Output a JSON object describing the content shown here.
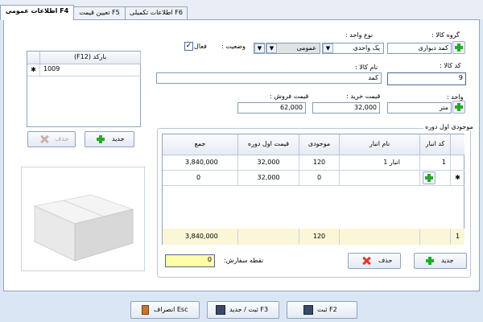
{
  "tabs": [
    {
      "label": "اطلاعات عمومی F4"
    },
    {
      "label": "تعیین قیمت F5"
    },
    {
      "label": "اطلاعات تکمیلی F6"
    }
  ],
  "form": {
    "item_group": {
      "label": "گروه کالا :",
      "value": "کمد دیواری"
    },
    "unit_type": {
      "label": "نوع واحد :",
      "value": "یک واحدی",
      "secondary_value": "عمومی"
    },
    "status": {
      "label": "وضعیت :",
      "checkbox_label": "فعال",
      "checked": true
    },
    "item_code": {
      "label": "کد کالا :",
      "value": "9"
    },
    "item_name": {
      "label": "نام کالا :",
      "value": "کمد"
    },
    "unit": {
      "label": "واحد :",
      "value": "متر"
    },
    "purchase_price": {
      "label": "قیمت خرید :",
      "value": "32,000"
    },
    "sale_price": {
      "label": "قیمت فروش :",
      "value": "62,000"
    }
  },
  "barcode": {
    "header": "(F12) بارکد",
    "rows": [
      "1009"
    ],
    "new_label": "جدید",
    "delete_label": "حذف"
  },
  "inventory": {
    "title": "موجودی اول دوره",
    "columns": [
      "کد انبار",
      "نام انبار",
      "موجودی",
      "قیمت اول دوره",
      "جمع"
    ],
    "rows": [
      {
        "code": "1",
        "warehouse": "انبار 1",
        "stock": "120",
        "price": "32,000",
        "total": "3,840,000"
      },
      {
        "code": "",
        "warehouse": "",
        "stock": "0",
        "price": "32,000",
        "total": "0"
      }
    ],
    "footer": {
      "count": "1",
      "stock": "120",
      "total": "3,840,000"
    },
    "new_label": "جدید",
    "delete_label": "حذف"
  },
  "reorder": {
    "label": "نقطه سفارش:",
    "value": "0"
  },
  "footer_buttons": {
    "save": "ثبت F2",
    "save_new": "ثبت / جدید F3",
    "cancel": "انصراف Esc"
  },
  "colors": {
    "accent": "#28a828",
    "highlight": "#ffffa8",
    "footer_row": "#fbf6d8",
    "delete": "#d83a2a"
  }
}
